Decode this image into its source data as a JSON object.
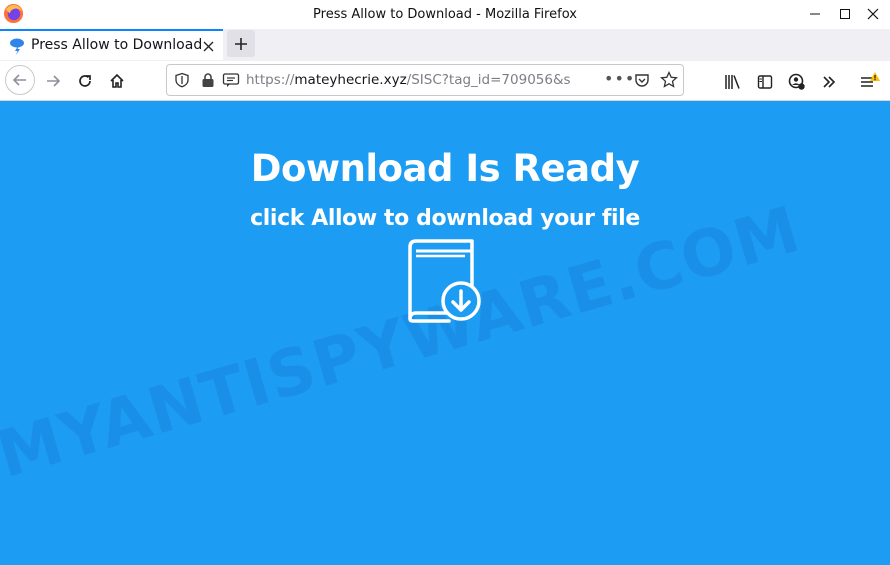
{
  "window": {
    "title": "Press Allow to Download - Mozilla Firefox"
  },
  "tab": {
    "label": "Press Allow to Download"
  },
  "urlbar": {
    "scheme": "https://",
    "host": "mateyhecrie.xyz",
    "path": "/SISC?tag_id=709056&s",
    "more": "•••"
  },
  "page": {
    "headline": "Download Is Ready",
    "subline": "click Allow to download your file",
    "watermark": "MYANTISPYWARE.COM",
    "background": "#1c9cf2"
  },
  "icons": {
    "firefox": "firefox-logo-icon",
    "favicon": "weather-favicon-icon",
    "book": "book-download-icon"
  }
}
